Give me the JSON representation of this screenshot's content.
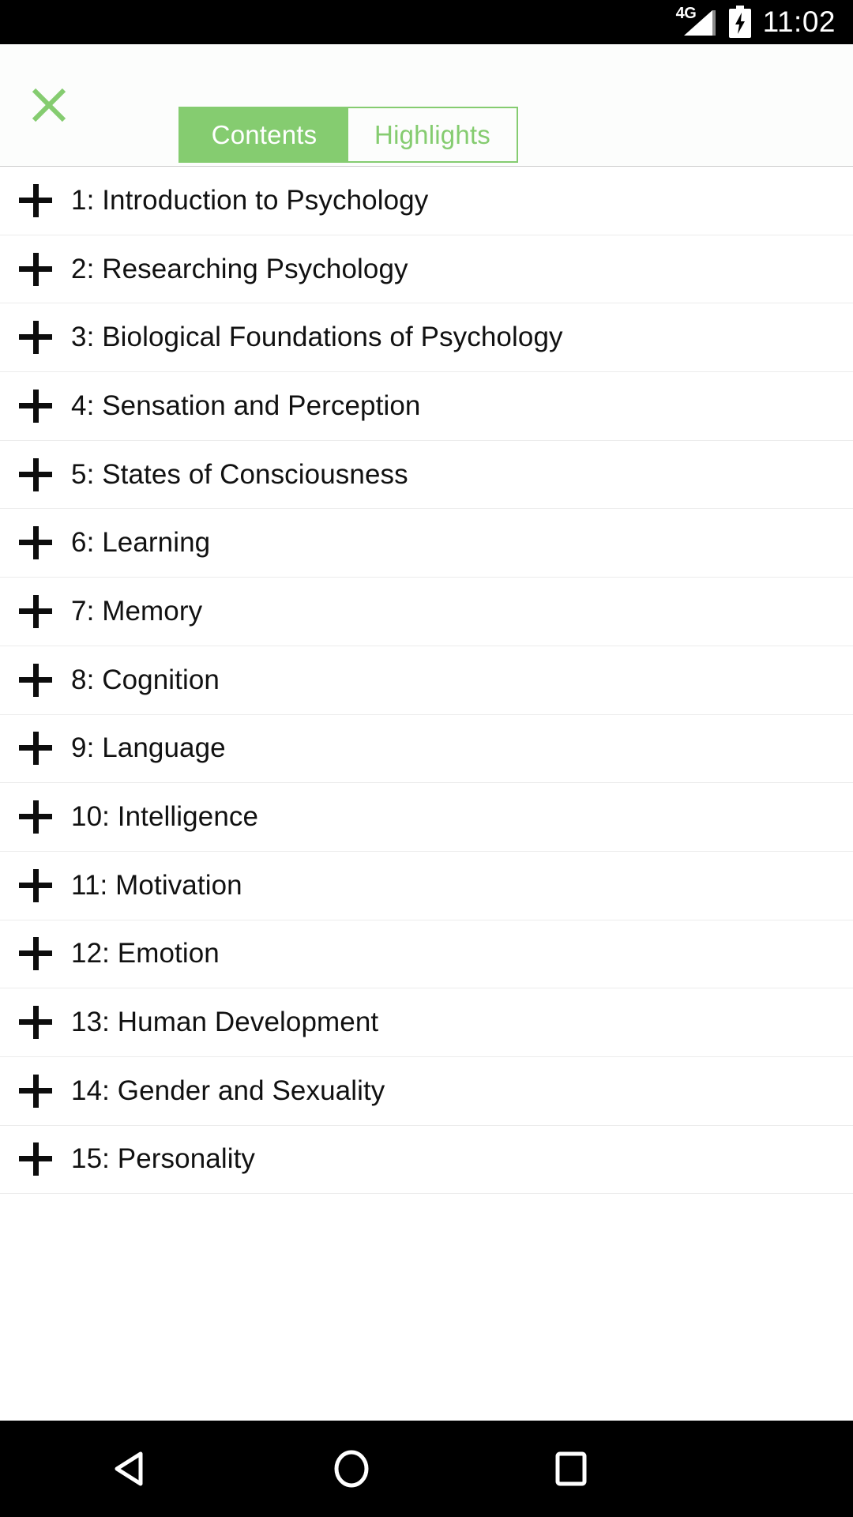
{
  "status_bar": {
    "network_label": "4G",
    "network_icon": "signal-bars-icon",
    "battery_icon": "battery-charging-icon",
    "time": "11:02"
  },
  "header": {
    "close_icon": "close-x-icon",
    "close_color": "#85cc70",
    "accent_color": "#85cc70",
    "tabs": [
      {
        "label": "Contents",
        "active": true
      },
      {
        "label": "Highlights",
        "active": false
      }
    ]
  },
  "toc": {
    "expand_icon": "plus-icon",
    "items": [
      {
        "label": "1: Introduction to Psychology"
      },
      {
        "label": "2: Researching Psychology"
      },
      {
        "label": "3: Biological Foundations of Psychology"
      },
      {
        "label": "4: Sensation and Perception"
      },
      {
        "label": "5: States of Consciousness"
      },
      {
        "label": "6: Learning"
      },
      {
        "label": "7: Memory"
      },
      {
        "label": "8: Cognition"
      },
      {
        "label": "9: Language"
      },
      {
        "label": "10: Intelligence"
      },
      {
        "label": "11: Motivation"
      },
      {
        "label": "12: Emotion"
      },
      {
        "label": "13: Human Development"
      },
      {
        "label": "14: Gender and Sexuality"
      },
      {
        "label": "15: Personality"
      }
    ]
  },
  "nav_bar": {
    "back_icon": "back-triangle-icon",
    "home_icon": "home-circle-icon",
    "recents_icon": "recents-square-icon"
  }
}
